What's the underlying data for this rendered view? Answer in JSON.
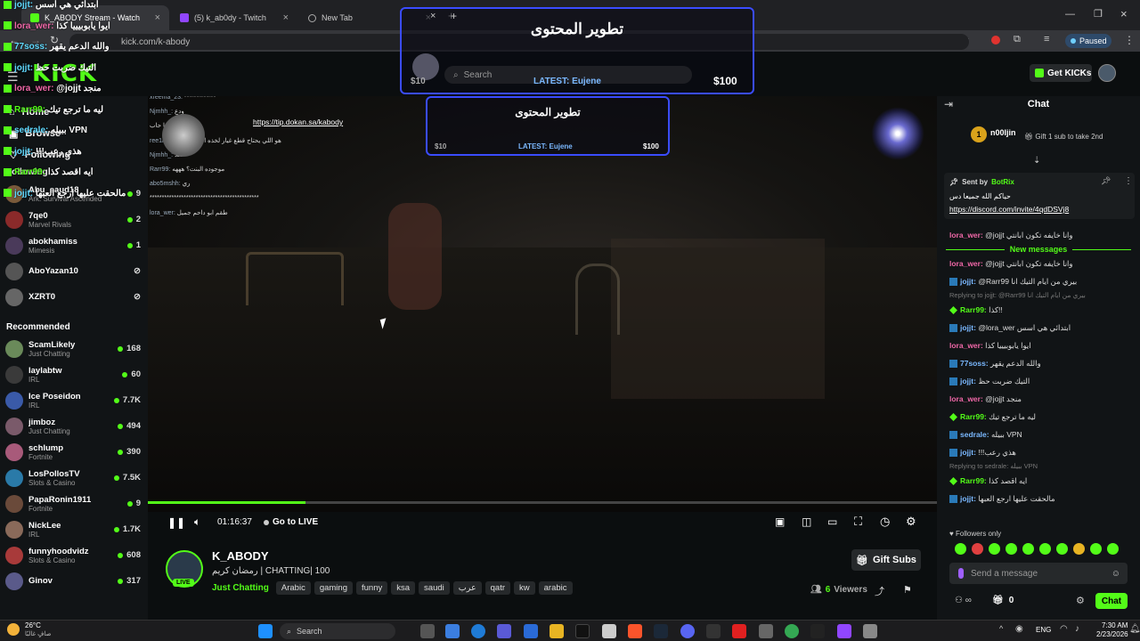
{
  "browser": {
    "tabs": [
      {
        "title": "K_ABODY Stream - Watch",
        "active": true
      },
      {
        "title": "(5) k_ab0dy - Twitch",
        "active": false
      },
      {
        "title": "New Tab",
        "active": false
      }
    ],
    "new_tab": "+",
    "url": "kick.com/k-abody",
    "profile_status": "Paused"
  },
  "kick": {
    "logo": "KICK",
    "get_kicks": "Get KICKs"
  },
  "sidebar": {
    "nav": [
      {
        "label": "Home",
        "icon": "home-icon"
      },
      {
        "label": "Browse",
        "icon": "browse-icon"
      },
      {
        "label": "Following",
        "icon": "heart-icon"
      }
    ],
    "following_title": "Following",
    "following": [
      {
        "name": "Abu_saud18",
        "game": "Ark: Survival Ascended",
        "count": "9",
        "live": true,
        "color": "#7a5a3a"
      },
      {
        "name": "7qe0",
        "game": "Marvel Rivals",
        "count": "2",
        "live": true,
        "color": "#8a2a2a"
      },
      {
        "name": "abokhamiss",
        "game": "Mimesis",
        "count": "1",
        "live": true,
        "color": "#4a3a5a"
      },
      {
        "name": "AboYazan10",
        "game": "",
        "count": "",
        "live": false,
        "color": "#555555"
      },
      {
        "name": "XZRT0",
        "game": "",
        "count": "",
        "live": false,
        "color": "#666666"
      }
    ],
    "recommended_title": "Recommended",
    "recommended": [
      {
        "name": "ScamLikely",
        "game": "Just Chatting",
        "count": "168",
        "color": "#6a8a5a"
      },
      {
        "name": "laylabtw",
        "game": "IRL",
        "count": "60",
        "color": "#3a3a3a"
      },
      {
        "name": "Ice Poseidon",
        "game": "IRL",
        "count": "7.7K",
        "color": "#3a5aa8"
      },
      {
        "name": "jimboz",
        "game": "Just Chatting",
        "count": "494",
        "color": "#7a5a6a"
      },
      {
        "name": "schlump",
        "game": "Fortnite",
        "count": "390",
        "color": "#a85a7a"
      },
      {
        "name": "LosPollosTV",
        "game": "Slots & Casino",
        "count": "7.5K",
        "color": "#2a7aa8"
      },
      {
        "name": "PapaRonin1911",
        "game": "Fortnite",
        "count": "9",
        "color": "#6a4a3a"
      },
      {
        "name": "NickLee",
        "game": "IRL",
        "count": "1.7K",
        "color": "#8a6a5a"
      },
      {
        "name": "funnyhoodvidz",
        "game": "Slots & Casino",
        "count": "608",
        "color": "#a83a3a"
      },
      {
        "name": "Ginov",
        "game": "",
        "count": "317",
        "color": "#5a5a8a"
      }
    ]
  },
  "overlay_chat": [
    {
      "user": "jojjt:",
      "text": "ابتدائي هي اسس",
      "color": "cyan"
    },
    {
      "user": "lora_wer:",
      "text": "ايوا يابوبيييا كذا",
      "color": "pink"
    },
    {
      "user": "77soss:",
      "text": "والله الدعم يقهر",
      "color": "cyan"
    },
    {
      "user": "jojjt:",
      "text": "التيك ضربت حظ",
      "color": "cyan"
    },
    {
      "user": "lora_wer:",
      "text": "@jojjt منجد",
      "color": "pink"
    },
    {
      "user": "Rarr99:",
      "text": "ليه ما ترجع تيك",
      "color": "green"
    },
    {
      "user": "sedrale:",
      "text": "ببيله VPN",
      "color": "cyan"
    },
    {
      "user": "jojjt:",
      "text": "!!!هذي رعب",
      "color": "cyan"
    },
    {
      "user": "Rarr99:",
      "text": "ايه اقصد كذا",
      "color": "green"
    },
    {
      "user": "jojjt:",
      "text": "مالحقت عليها ارجع العبها",
      "color": "cyan"
    }
  ],
  "stream_overlay": {
    "goal_title": "تطوير المحتوى",
    "goal_search": "Search",
    "goal_latest": "LATEST: Eujene",
    "goal_left": "$10",
    "goal_right": "$100",
    "goal2_title": "تطوير المحتوى",
    "goal2_latest": "LATEST: Eujene",
    "goal2_left": "$10",
    "goal2_right": "$100",
    "tip_link": "https://tip.dokan.sa/kabody",
    "ingame_chat": [
      {
        "user": "xreema_23:",
        "text": "*************"
      },
      {
        "user": "Njmhh_:",
        "text": "ودع"
      },
      {
        "user": "",
        "text": "انا حاب"
      },
      {
        "user": "ree1ri:",
        "text": "هو اللي يحتاج قطع غيار لخذه الحين مو اليوم"
      },
      {
        "user": "Njmhh_:",
        "text": "فعلا"
      },
      {
        "user": "Rarr99:",
        "text": "موجوده البنت؟ هههه"
      },
      {
        "user": "abo5mshh:",
        "text": "ري"
      },
      {
        "user": "",
        "text": "*********************************************"
      },
      {
        "user": "lora_wer:",
        "text": "طقم ابو داحم جميل"
      }
    ]
  },
  "player": {
    "time": "01:16:37",
    "go_live": "Go to LIVE",
    "progress": 0.2
  },
  "stream_info": {
    "streamer": "K_ABODY",
    "live_badge": "LIVE",
    "title": "رمضان كريم | CHATTING| 100",
    "category": "Just Chatting",
    "tags": [
      "Arabic",
      "gaming",
      "funny",
      "ksa",
      "saudi",
      "عرب",
      "qatr",
      "kw",
      "arabic"
    ],
    "gift_subs": "Gift Subs",
    "viewers_count": "6",
    "viewers_label": "Viewers"
  },
  "chat": {
    "title": "Chat",
    "gifter": "n00ljin",
    "gifter_badge": "1",
    "gift_prompt": "Gift 1 sub to take 2nd",
    "pinned_sent_by": "Sent by",
    "pinned_bot": "BotRix",
    "pinned_text": "حياكم الله جميعا دس",
    "pinned_link": "https://discord.com/invite/4qdDSVj8",
    "new_messages": "New messages",
    "messages": [
      {
        "user": "lora_wer:",
        "text": "@jojjt وانا خايفه تكون ابانتي",
        "color": "pink",
        "reply": ""
      },
      {
        "user": "lora_wer:",
        "text": "@jojjt وانا خايفه تكون ابانتي",
        "color": "pink",
        "reply": ""
      },
      {
        "user": "jojjt:",
        "text": "@Rarr99 بيري من ايام التيك انا",
        "color": "blue",
        "reply": ""
      },
      {
        "user": "Rarr99:",
        "text": "كذا!!",
        "color": "green",
        "reply": "Replying to jojjt: @Rarr99 بيري من ايام التيك انا"
      },
      {
        "user": "jojjt:",
        "text": "@lora_wer ابتدائي هي اسس",
        "color": "blue",
        "reply": ""
      },
      {
        "user": "lora_wer:",
        "text": "ايوا يابوبيييا كذا",
        "color": "pink",
        "reply": ""
      },
      {
        "user": "77soss:",
        "text": "والله الدعم يقهر",
        "color": "blue",
        "reply": ""
      },
      {
        "user": "jojjt:",
        "text": "التيك ضربت حظ",
        "color": "blue",
        "reply": ""
      },
      {
        "user": "lora_wer:",
        "text": "@jojjt منجد",
        "color": "pink",
        "reply": ""
      },
      {
        "user": "Rarr99:",
        "text": "ليه ما ترجع تيك",
        "color": "green",
        "reply": ""
      },
      {
        "user": "sedrale:",
        "text": "ببيله VPN",
        "color": "blue",
        "reply": ""
      },
      {
        "user": "jojjt:",
        "text": "!!!هذي رعب",
        "color": "blue",
        "reply": ""
      },
      {
        "user": "Rarr99:",
        "text": "ايه اقصد كذا",
        "color": "green",
        "reply": "Replying to sedrale: ببيله VPN"
      },
      {
        "user": "jojjt:",
        "text": "مالحقت عليها ارجع العبها",
        "color": "blue",
        "reply": ""
      }
    ],
    "followers_only": "Followers only",
    "input_placeholder": "Send a message",
    "kicks_count": "0",
    "send_label": "Chat"
  },
  "taskbar": {
    "weather_temp": "26°C",
    "weather_text": "صافٍ غالبًا",
    "search": "Search",
    "lang": "ENG",
    "time": "7:30 AM",
    "date": "2/23/2026"
  },
  "colors": {
    "kick_green": "#53fc18",
    "accent_blue": "#3a4cff"
  }
}
